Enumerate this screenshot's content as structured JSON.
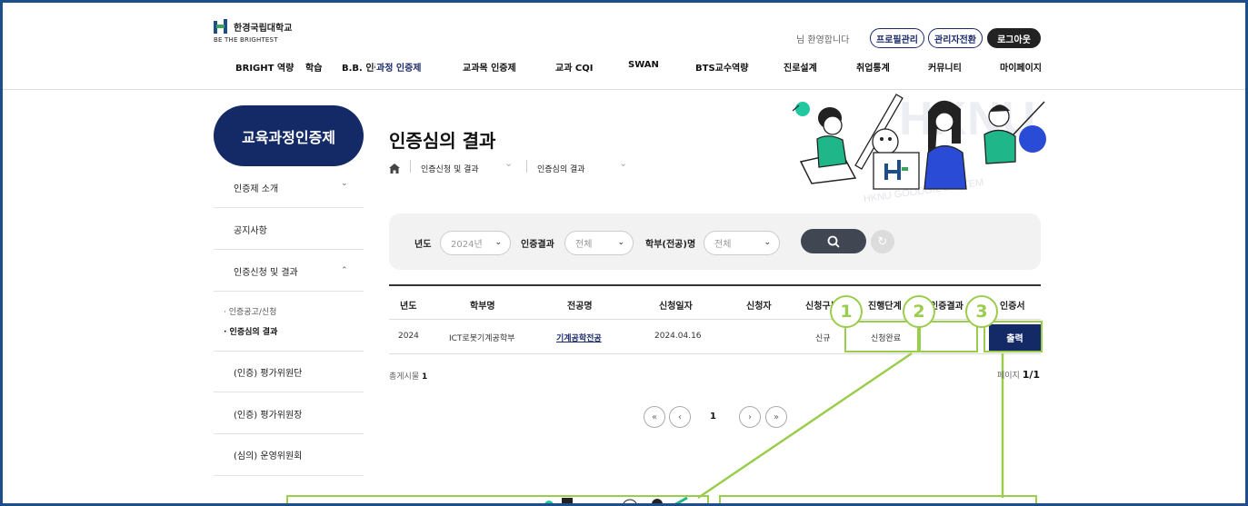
{
  "header": {
    "logo_text": "한경국립대학교",
    "logo_sub": "BE THE BRIGHTEST",
    "welcome": "님 환영합니다",
    "profile_btn": "프로필관리",
    "admin_btn": "관리자전환",
    "logout_btn": "로그아웃",
    "nav": [
      "BRIGHT 역량",
      "학습",
      "B.B. 인증",
      "과정 인증제",
      "교과목 인증제",
      "교과 CQI",
      "SWAN",
      "BTS교수역량",
      "진로설계",
      "취업통계",
      "커뮤니티",
      "마이페이지"
    ]
  },
  "sidebar": {
    "title": "교육과정인증제",
    "items": [
      {
        "label": "인증제 소개",
        "chevron": "⌄"
      },
      {
        "label": "공지사항"
      },
      {
        "label": "인증신청 및 결과",
        "chevron": "⌃"
      },
      {
        "label": "(인증) 평가위원단"
      },
      {
        "label": "(인증) 평가위원장"
      },
      {
        "label": "(심의) 운영위원회"
      }
    ],
    "sub_items": [
      "· 인증공고/신청",
      "· 인증심의 결과"
    ]
  },
  "main": {
    "title": "인증심의 결과",
    "breadcrumb": [
      "인증신청 및 결과",
      "인증심의 결과"
    ],
    "banner_text": "HKNU GOODGIL SYSTEM",
    "banner_big": "HKNU",
    "filter": {
      "year_label": "년도",
      "year_value": "2024년",
      "result_label": "인증결과",
      "result_value": "전체",
      "dept_label": "학부(전공)명",
      "dept_value": "전체"
    },
    "table": {
      "headers": [
        "년도",
        "학부명",
        "전공명",
        "신청일자",
        "신청자",
        "신청구분",
        "진행단계",
        "인증결과",
        "인증서"
      ],
      "rows": [
        {
          "year": "2024",
          "dept": "ICT로봇기계공학부",
          "major": "기계공학전공",
          "date": "2024.04.16",
          "applicant": "",
          "type": "신규",
          "stage": "신청완료",
          "result": "",
          "cert": "출력"
        }
      ]
    },
    "total_label": "총게시물",
    "total_count": "1",
    "page_label": "페이지",
    "page_value": "1/1",
    "current_page": "1",
    "markers": [
      "1",
      "2",
      "3"
    ]
  },
  "colors": {
    "navy": "#142a66",
    "accent_green": "#9acd4c",
    "frame": "#1d4e8a"
  }
}
